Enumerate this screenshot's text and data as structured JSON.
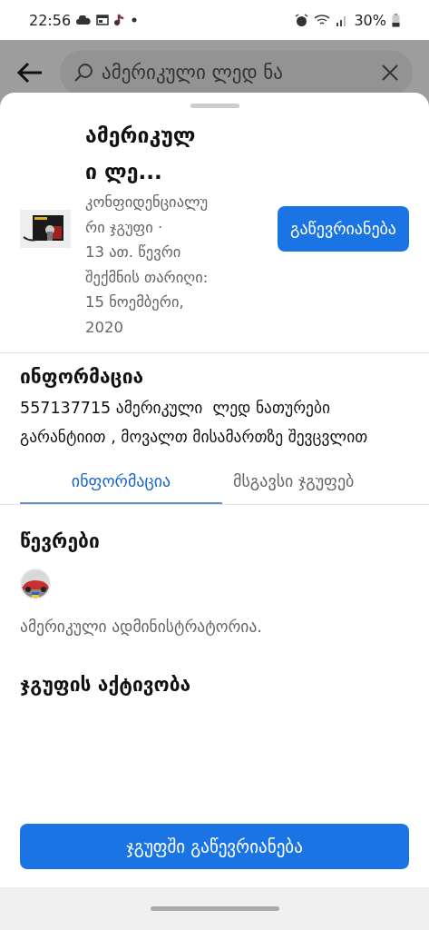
{
  "status_bar": {
    "time": "22:56",
    "battery": "30%"
  },
  "search": {
    "value": "ამერიკული ლედ ნა"
  },
  "group": {
    "name": "ამერიკული ლე...",
    "privacy": "კონფიდენციალური ჯგუფი ·",
    "details": "13 ათ. წევრი შექმნის თარიღი: 15 ნოემბერი, 2020",
    "join_button": "გაწევრიანება"
  },
  "about": {
    "heading": "ინფორმაცია",
    "text": "557137715 ამერიკული  ლედ ნათურები გარანტიით , მოვალთ მისამართზე შევცვლით"
  },
  "tabs": [
    {
      "label": "ინფორმაცია",
      "selected": true
    },
    {
      "label": "მსგავსი ჯგუფებ",
      "selected": false
    }
  ],
  "members": {
    "heading": "წევრები",
    "admin_text": "ამერიკული ადმინისტრატორია."
  },
  "activity": {
    "heading": "ჯგუფის აქტივობა"
  },
  "footer_button": "ჯგუფში გაწევრიანება"
}
